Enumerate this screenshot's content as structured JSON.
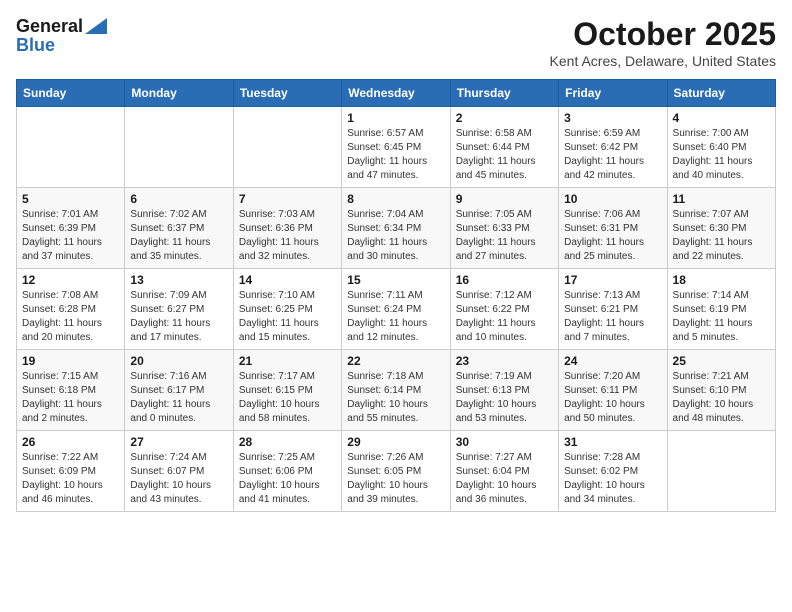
{
  "logo": {
    "general": "General",
    "blue": "Blue"
  },
  "title": "October 2025",
  "subtitle": "Kent Acres, Delaware, United States",
  "days_of_week": [
    "Sunday",
    "Monday",
    "Tuesday",
    "Wednesday",
    "Thursday",
    "Friday",
    "Saturday"
  ],
  "weeks": [
    [
      {
        "day": "",
        "info": ""
      },
      {
        "day": "",
        "info": ""
      },
      {
        "day": "",
        "info": ""
      },
      {
        "day": "1",
        "info": "Sunrise: 6:57 AM\nSunset: 6:45 PM\nDaylight: 11 hours and 47 minutes."
      },
      {
        "day": "2",
        "info": "Sunrise: 6:58 AM\nSunset: 6:44 PM\nDaylight: 11 hours and 45 minutes."
      },
      {
        "day": "3",
        "info": "Sunrise: 6:59 AM\nSunset: 6:42 PM\nDaylight: 11 hours and 42 minutes."
      },
      {
        "day": "4",
        "info": "Sunrise: 7:00 AM\nSunset: 6:40 PM\nDaylight: 11 hours and 40 minutes."
      }
    ],
    [
      {
        "day": "5",
        "info": "Sunrise: 7:01 AM\nSunset: 6:39 PM\nDaylight: 11 hours and 37 minutes."
      },
      {
        "day": "6",
        "info": "Sunrise: 7:02 AM\nSunset: 6:37 PM\nDaylight: 11 hours and 35 minutes."
      },
      {
        "day": "7",
        "info": "Sunrise: 7:03 AM\nSunset: 6:36 PM\nDaylight: 11 hours and 32 minutes."
      },
      {
        "day": "8",
        "info": "Sunrise: 7:04 AM\nSunset: 6:34 PM\nDaylight: 11 hours and 30 minutes."
      },
      {
        "day": "9",
        "info": "Sunrise: 7:05 AM\nSunset: 6:33 PM\nDaylight: 11 hours and 27 minutes."
      },
      {
        "day": "10",
        "info": "Sunrise: 7:06 AM\nSunset: 6:31 PM\nDaylight: 11 hours and 25 minutes."
      },
      {
        "day": "11",
        "info": "Sunrise: 7:07 AM\nSunset: 6:30 PM\nDaylight: 11 hours and 22 minutes."
      }
    ],
    [
      {
        "day": "12",
        "info": "Sunrise: 7:08 AM\nSunset: 6:28 PM\nDaylight: 11 hours and 20 minutes."
      },
      {
        "day": "13",
        "info": "Sunrise: 7:09 AM\nSunset: 6:27 PM\nDaylight: 11 hours and 17 minutes."
      },
      {
        "day": "14",
        "info": "Sunrise: 7:10 AM\nSunset: 6:25 PM\nDaylight: 11 hours and 15 minutes."
      },
      {
        "day": "15",
        "info": "Sunrise: 7:11 AM\nSunset: 6:24 PM\nDaylight: 11 hours and 12 minutes."
      },
      {
        "day": "16",
        "info": "Sunrise: 7:12 AM\nSunset: 6:22 PM\nDaylight: 11 hours and 10 minutes."
      },
      {
        "day": "17",
        "info": "Sunrise: 7:13 AM\nSunset: 6:21 PM\nDaylight: 11 hours and 7 minutes."
      },
      {
        "day": "18",
        "info": "Sunrise: 7:14 AM\nSunset: 6:19 PM\nDaylight: 11 hours and 5 minutes."
      }
    ],
    [
      {
        "day": "19",
        "info": "Sunrise: 7:15 AM\nSunset: 6:18 PM\nDaylight: 11 hours and 2 minutes."
      },
      {
        "day": "20",
        "info": "Sunrise: 7:16 AM\nSunset: 6:17 PM\nDaylight: 11 hours and 0 minutes."
      },
      {
        "day": "21",
        "info": "Sunrise: 7:17 AM\nSunset: 6:15 PM\nDaylight: 10 hours and 58 minutes."
      },
      {
        "day": "22",
        "info": "Sunrise: 7:18 AM\nSunset: 6:14 PM\nDaylight: 10 hours and 55 minutes."
      },
      {
        "day": "23",
        "info": "Sunrise: 7:19 AM\nSunset: 6:13 PM\nDaylight: 10 hours and 53 minutes."
      },
      {
        "day": "24",
        "info": "Sunrise: 7:20 AM\nSunset: 6:11 PM\nDaylight: 10 hours and 50 minutes."
      },
      {
        "day": "25",
        "info": "Sunrise: 7:21 AM\nSunset: 6:10 PM\nDaylight: 10 hours and 48 minutes."
      }
    ],
    [
      {
        "day": "26",
        "info": "Sunrise: 7:22 AM\nSunset: 6:09 PM\nDaylight: 10 hours and 46 minutes."
      },
      {
        "day": "27",
        "info": "Sunrise: 7:24 AM\nSunset: 6:07 PM\nDaylight: 10 hours and 43 minutes."
      },
      {
        "day": "28",
        "info": "Sunrise: 7:25 AM\nSunset: 6:06 PM\nDaylight: 10 hours and 41 minutes."
      },
      {
        "day": "29",
        "info": "Sunrise: 7:26 AM\nSunset: 6:05 PM\nDaylight: 10 hours and 39 minutes."
      },
      {
        "day": "30",
        "info": "Sunrise: 7:27 AM\nSunset: 6:04 PM\nDaylight: 10 hours and 36 minutes."
      },
      {
        "day": "31",
        "info": "Sunrise: 7:28 AM\nSunset: 6:02 PM\nDaylight: 10 hours and 34 minutes."
      },
      {
        "day": "",
        "info": ""
      }
    ]
  ]
}
